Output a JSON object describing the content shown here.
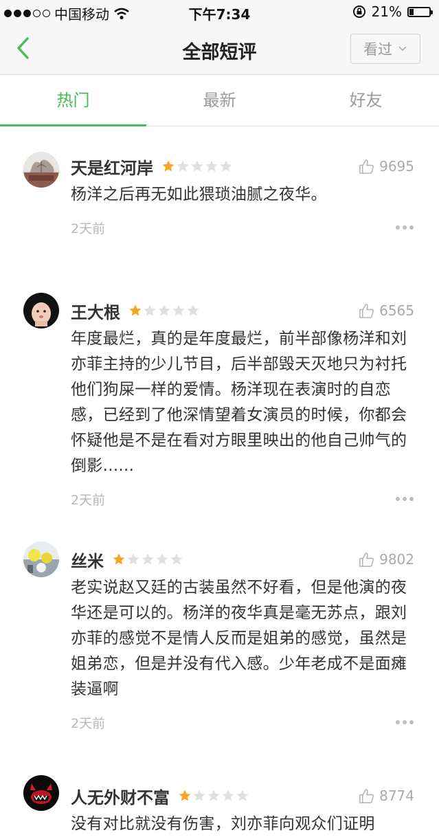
{
  "status_bar": {
    "carrier": "中国移动",
    "time": "下午7:34",
    "battery": "21%",
    "battery_level": 0.21
  },
  "nav": {
    "title": "全部短评",
    "filter_label": "看过"
  },
  "tabs": [
    {
      "label": "热门",
      "active": true
    },
    {
      "label": "最新",
      "active": false
    },
    {
      "label": "好友",
      "active": false
    }
  ],
  "colors": {
    "accent": "#42bd56",
    "star": "#f6a623",
    "star_empty": "#e0e0e0"
  },
  "reviews": [
    {
      "user": "天是红河岸",
      "rating": 1,
      "likes": "9695",
      "content": "杨洋之后再无如此猥琐油腻之夜华。",
      "time": "2天前",
      "avatar": "landscape-avatar"
    },
    {
      "user": "王大根",
      "rating": 1,
      "likes": "6565",
      "content": "年度最烂，真的是年度最烂，前半部像杨洋和刘亦菲主持的少儿节目，后半部毁天灭地只为衬托他们狗屎一样的爱情。杨洋现在表演时的自恋感，已经到了他深情望着女演员的时候，你都会怀疑他是不是在看对方眼里映出的他自己帅气的倒影......",
      "time": "2天前",
      "avatar": "cartoon-avatar"
    },
    {
      "user": "丝米",
      "rating": 1,
      "likes": "9802",
      "content": "老实说赵又廷的古装虽然不好看，但是他演的夜华还是可以的。杨洋的夜华真是毫无苏点，跟刘亦菲的感觉不是情人反而是姐弟的感觉，虽然是姐弟恋，但是并没有代入感。少年老成不是面瘫装逼啊",
      "time": "2天前",
      "avatar": "flower-avatar"
    },
    {
      "user": "人无外财不富",
      "rating": 1,
      "likes": "8774",
      "content": "没有对比就没有伤害，刘亦菲向观众们证明",
      "time": "",
      "avatar": "monster-avatar"
    }
  ]
}
